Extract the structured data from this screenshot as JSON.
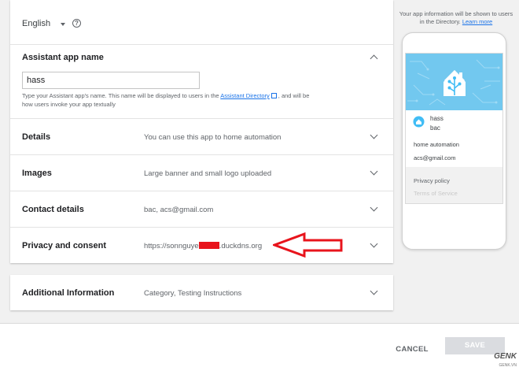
{
  "language": {
    "label": "English",
    "help_icon": "help-circle-icon"
  },
  "sections": {
    "name": {
      "title": "Assistant app name",
      "input_value": "hass",
      "help_prefix": "Type your Assistant app's name. This name will be displayed to users in the ",
      "help_link": "Assistant Directory",
      "help_suffix": ", and will be how users invoke your app textually"
    },
    "details": {
      "title": "Details",
      "value": "You can use this app to home automation"
    },
    "images": {
      "title": "Images",
      "value": "Large banner and small logo uploaded"
    },
    "contact": {
      "title": "Contact details",
      "value": "bac, acs@gmail.com"
    },
    "privacy": {
      "title": "Privacy and consent",
      "value_prefix": "https://sonnguye",
      "value_suffix": ".duckdns.org",
      "redaction_color": "#e8141c"
    },
    "additional": {
      "title": "Additional Information",
      "value": "Category, Testing Instructions"
    }
  },
  "preview": {
    "note_text": "Your app information will be shown to users in the Directory.",
    "note_link": "Learn more",
    "app_name": "hass",
    "app_subtitle": "bac",
    "description": "home automation",
    "email": "acs@gmail.com",
    "privacy_link": "Privacy policy",
    "terms_link": "Terms of Service",
    "banner_color": "#72c8ef"
  },
  "footer": {
    "cancel_label": "CANCEL",
    "save_label": "SAVE"
  },
  "watermark": {
    "brand": "GENK",
    "site": "GENK.VN"
  },
  "annotation": {
    "arrow_color": "#e8141c"
  }
}
